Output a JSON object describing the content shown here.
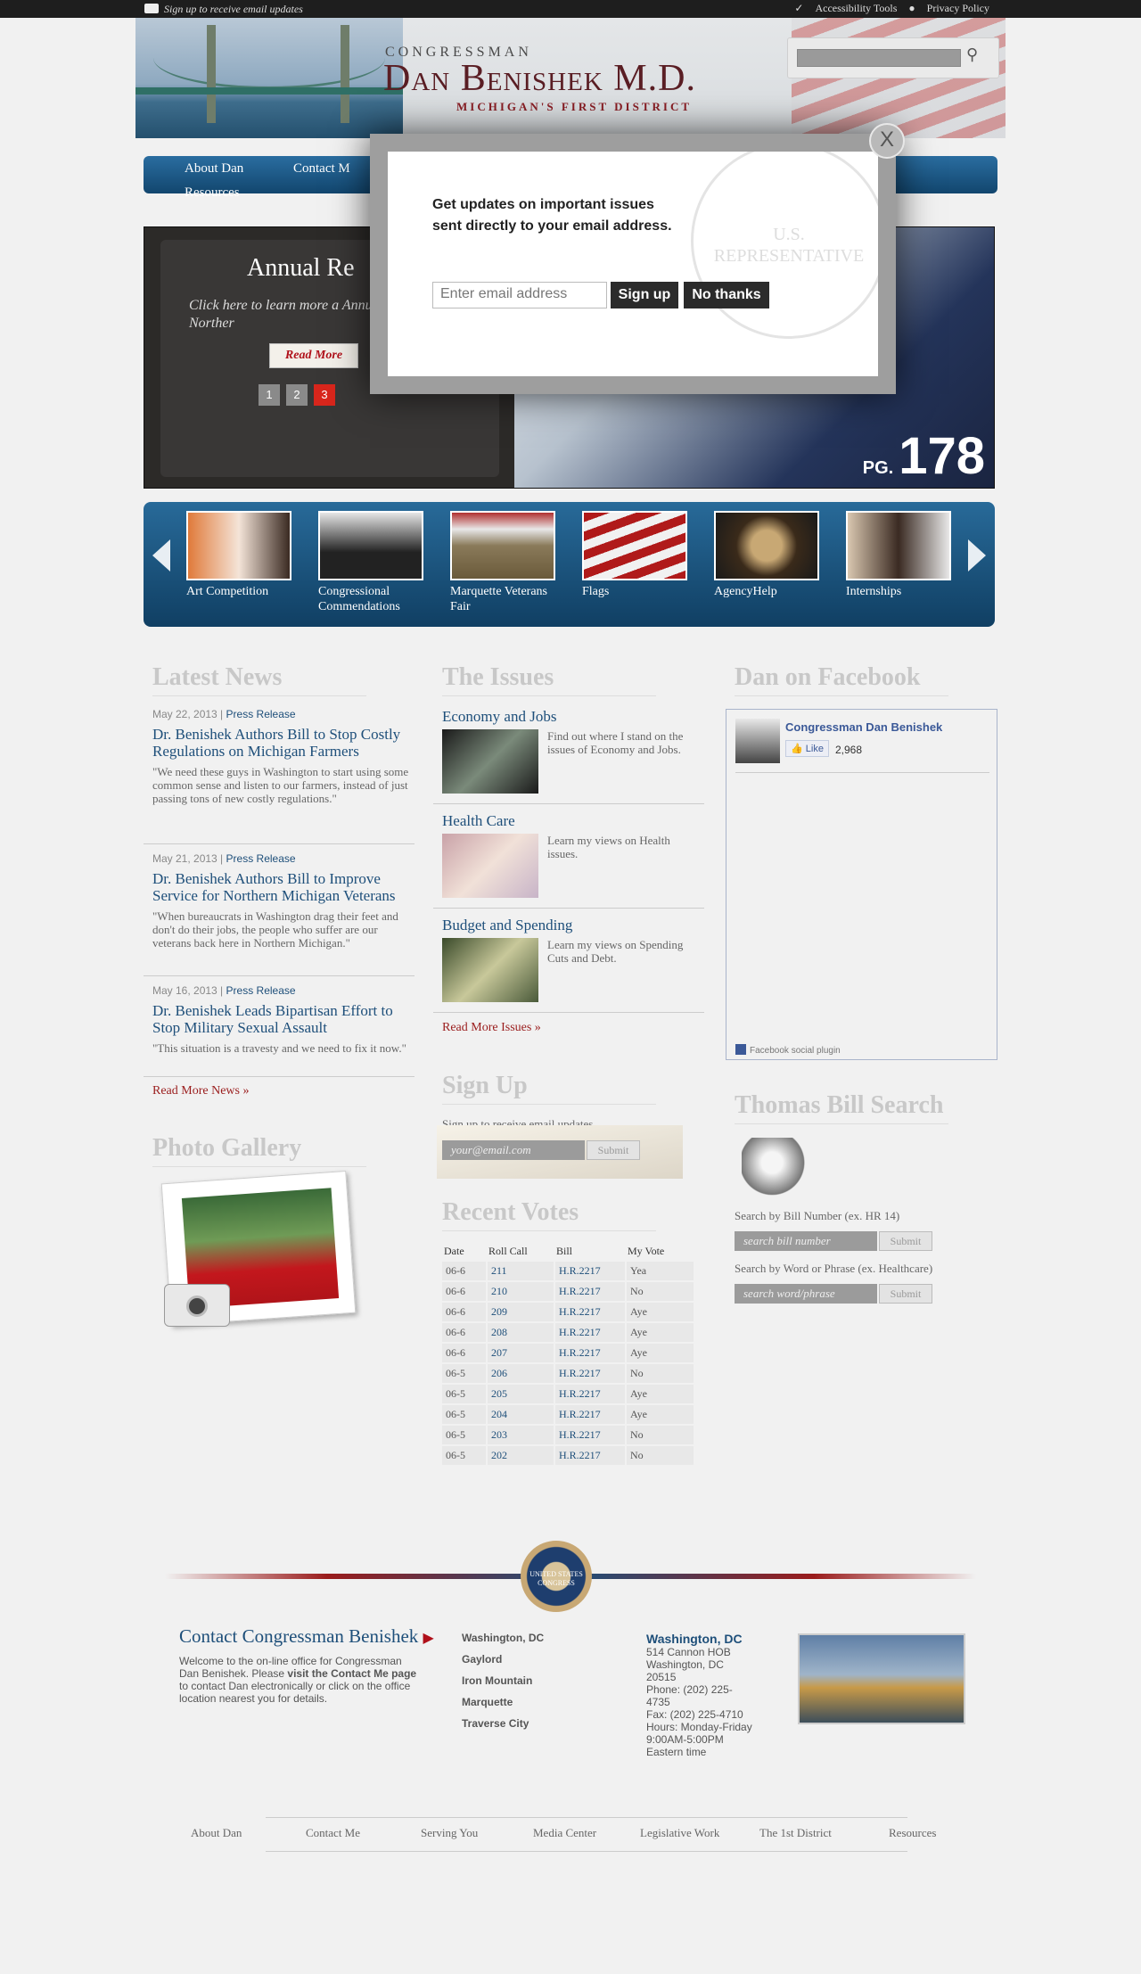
{
  "topbar": {
    "signup": "Sign up to receive email updates",
    "accessibility": "Accessibility Tools",
    "privacy": "Privacy Policy"
  },
  "header": {
    "congressman": "CONGRESSMAN",
    "name": "Dan Benishek M.D.",
    "district": "MICHIGAN'S FIRST DISTRICT"
  },
  "nav": {
    "items": [
      "About Dan",
      "Contact M",
      "Resources"
    ]
  },
  "slider": {
    "title": "Annual Re",
    "desc": "Click here to learn more a Annual Report to Norther",
    "read_more": "Read More",
    "dots": [
      "1",
      "2",
      "3"
    ],
    "pg_label": "PG.",
    "pg_number": "178"
  },
  "carousel": {
    "items": [
      {
        "label": "Art Competition"
      },
      {
        "label": "Congressional Commendations"
      },
      {
        "label": "Marquette Veterans Fair"
      },
      {
        "label": "Flags"
      },
      {
        "label": "AgencyHelp"
      },
      {
        "label": "Internships"
      }
    ]
  },
  "latest_news": {
    "heading": "Latest News",
    "items": [
      {
        "date": "May 22, 2013",
        "type": "Press Release",
        "title": "Dr. Benishek Authors Bill to Stop Costly Regulations on Michigan Farmers",
        "quote": "\"We need these guys in Washington to start using some common sense and listen to our farmers, instead of just passing tons of new costly regulations.\""
      },
      {
        "date": "May 21, 2013",
        "type": "Press Release",
        "title": "Dr. Benishek Authors Bill to Improve Service for Northern Michigan Veterans",
        "quote": "\"When bureaucrats in Washington drag their feet and don't do their jobs, the people who suffer are our veterans back here in Northern Michigan.\""
      },
      {
        "date": "May 16, 2013",
        "type": "Press Release",
        "title": "Dr. Benishek Leads Bipartisan Effort to Stop Military Sexual Assault",
        "quote": "\"This situation is a travesty and we need to fix it now.\""
      }
    ],
    "more": "Read More News »"
  },
  "photo_gallery": {
    "heading": "Photo Gallery"
  },
  "issues": {
    "heading": "The Issues",
    "items": [
      {
        "title": "Economy and Jobs",
        "desc": "Find out where I stand on the issues of Economy and Jobs."
      },
      {
        "title": "Health Care",
        "desc": "Learn my views on Health issues."
      },
      {
        "title": "Budget and Spending",
        "desc": "Learn my views on Spending Cuts and Debt."
      }
    ],
    "more": "Read More Issues »"
  },
  "signup": {
    "heading": "Sign Up",
    "text": "Sign up to receive email updates",
    "placeholder": "your@email.com",
    "submit": "Submit"
  },
  "recent_votes": {
    "heading": "Recent Votes",
    "columns": [
      "Date",
      "Roll Call",
      "Bill",
      "My Vote"
    ],
    "rows": [
      [
        "06-6",
        "211",
        "H.R.2217",
        "Yea"
      ],
      [
        "06-6",
        "210",
        "H.R.2217",
        "No"
      ],
      [
        "06-6",
        "209",
        "H.R.2217",
        "Aye"
      ],
      [
        "06-6",
        "208",
        "H.R.2217",
        "Aye"
      ],
      [
        "06-6",
        "207",
        "H.R.2217",
        "Aye"
      ],
      [
        "06-5",
        "206",
        "H.R.2217",
        "No"
      ],
      [
        "06-5",
        "205",
        "H.R.2217",
        "Aye"
      ],
      [
        "06-5",
        "204",
        "H.R.2217",
        "Aye"
      ],
      [
        "06-5",
        "203",
        "H.R.2217",
        "No"
      ],
      [
        "06-5",
        "202",
        "H.R.2217",
        "No"
      ]
    ]
  },
  "facebook": {
    "heading": "Dan on Facebook",
    "page_name": "Congressman Dan Benishek",
    "like": "Like",
    "count": "2,968",
    "plugin": "Facebook social plugin"
  },
  "thomas": {
    "heading": "Thomas Bill Search",
    "by_number": "Search by Bill Number (ex. HR 14)",
    "number_placeholder": "search bill number",
    "by_word": "Search by Word or Phrase (ex. Healthcare)",
    "word_placeholder": "search word/phrase",
    "submit": "Submit"
  },
  "footer": {
    "seal": "UNITED STATES CONGRESS",
    "contact_heading": "Contact Congressman Benishek",
    "welcome_1": "Welcome to the on-line office for Congressman Dan Benishek. Please ",
    "welcome_bold": "visit the Contact Me page",
    "welcome_2": " to contact Dan electronically or click on the office location nearest you for details.",
    "locations": [
      "Washington, DC",
      "Gaylord",
      "Iron Mountain",
      "Marquette",
      "Traverse City"
    ],
    "office": {
      "city": "Washington, DC",
      "line1": "514 Cannon HOB",
      "line2": "Washington, DC",
      "line3": "20515",
      "phone": "Phone: (202) 225-4735",
      "fax": "Fax: (202) 225-4710",
      "hours": "Hours: Monday-Friday 9:00AM-5:00PM Eastern time"
    },
    "nav": [
      "About Dan",
      "Contact Me",
      "Serving You",
      "Media Center",
      "Legislative Work",
      "The 1st District",
      "Resources"
    ]
  },
  "modal": {
    "message": "Get updates on important issues sent directly to your email address.",
    "placeholder": "Enter email address",
    "signup": "Sign up",
    "no_thanks": "No thanks",
    "close": "X",
    "watermark": "U.S. REPRESENTATIVE"
  }
}
